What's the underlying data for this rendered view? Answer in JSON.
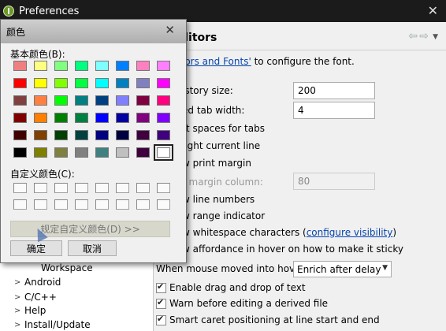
{
  "window": {
    "title": "Preferences",
    "close_glyph": "✕"
  },
  "page": {
    "title": "Text Editors",
    "title_visible": "ditors",
    "nav_back_glyph": "⇦",
    "nav_forward_glyph": "⇨",
    "nav_menu_glyph": "▼"
  },
  "intro": {
    "link_text": "lors and Fonts'",
    "rest_text": " to configure the font."
  },
  "options": {
    "history_label": "istory size:",
    "history_value": "200",
    "tab_width_label": "ed tab width:",
    "tab_width_value": "4",
    "insert_spaces_label": "rt spaces for tabs",
    "highlight_line_label": "light current line",
    "print_margin_label": "w print margin",
    "margin_column_label": "t margin column:",
    "margin_column_value": "80",
    "line_numbers_label": "w line numbers",
    "range_indicator_label": "w range indicator",
    "whitespace_label": "w whitespace characters (",
    "whitespace_link": "configure visibility",
    "whitespace_close": ")",
    "affordance_label": "w affordance in hover on how to make it sticky",
    "hover_label": "When mouse moved into hover:",
    "hover_value": "Enrich after delay",
    "drag_drop_label": "Enable drag and drop of text",
    "warn_derived_label": "Warn before editing a derived file",
    "smart_caret_label": "Smart caret positioning at line start and end"
  },
  "tree": {
    "items": [
      {
        "label": "Workspace",
        "arrow": ""
      },
      {
        "label": "Android",
        "arrow": ">"
      },
      {
        "label": "C/C++",
        "arrow": ">"
      },
      {
        "label": "Help",
        "arrow": ">"
      },
      {
        "label": "Install/Update",
        "arrow": ">"
      }
    ]
  },
  "color_dialog": {
    "title": "颜色",
    "close_glyph": "✕",
    "basic_label": "基本颜色(B):",
    "custom_label": "自定义颜色(C):",
    "define_button": "规定自定义颜色(D) >>",
    "ok_button": "确定",
    "cancel_button": "取消",
    "basic_colors": [
      "#f08080",
      "#ffff80",
      "#80ff80",
      "#00ff80",
      "#80ffff",
      "#0080ff",
      "#ff80c0",
      "#ff80ff",
      "#ff0000",
      "#ffff00",
      "#80ff00",
      "#00ff40",
      "#00ffff",
      "#0080c0",
      "#8080c0",
      "#ff00ff",
      "#804040",
      "#ff8040",
      "#00ff00",
      "#008080",
      "#004080",
      "#8080ff",
      "#800040",
      "#ff0080",
      "#800000",
      "#ff8000",
      "#008000",
      "#008040",
      "#0000ff",
      "#0000a0",
      "#800080",
      "#8000ff",
      "#400000",
      "#804000",
      "#004000",
      "#004040",
      "#000080",
      "#000040",
      "#400040",
      "#400080",
      "#000000",
      "#808000",
      "#808040",
      "#808080",
      "#408080",
      "#c0c0c0",
      "#400040",
      "#ffffff"
    ],
    "selected_index": 47,
    "custom_colors": [
      "",
      "",
      "",
      "",
      "",
      "",
      "",
      "",
      "",
      "",
      "",
      "",
      "",
      "",
      "",
      ""
    ]
  }
}
